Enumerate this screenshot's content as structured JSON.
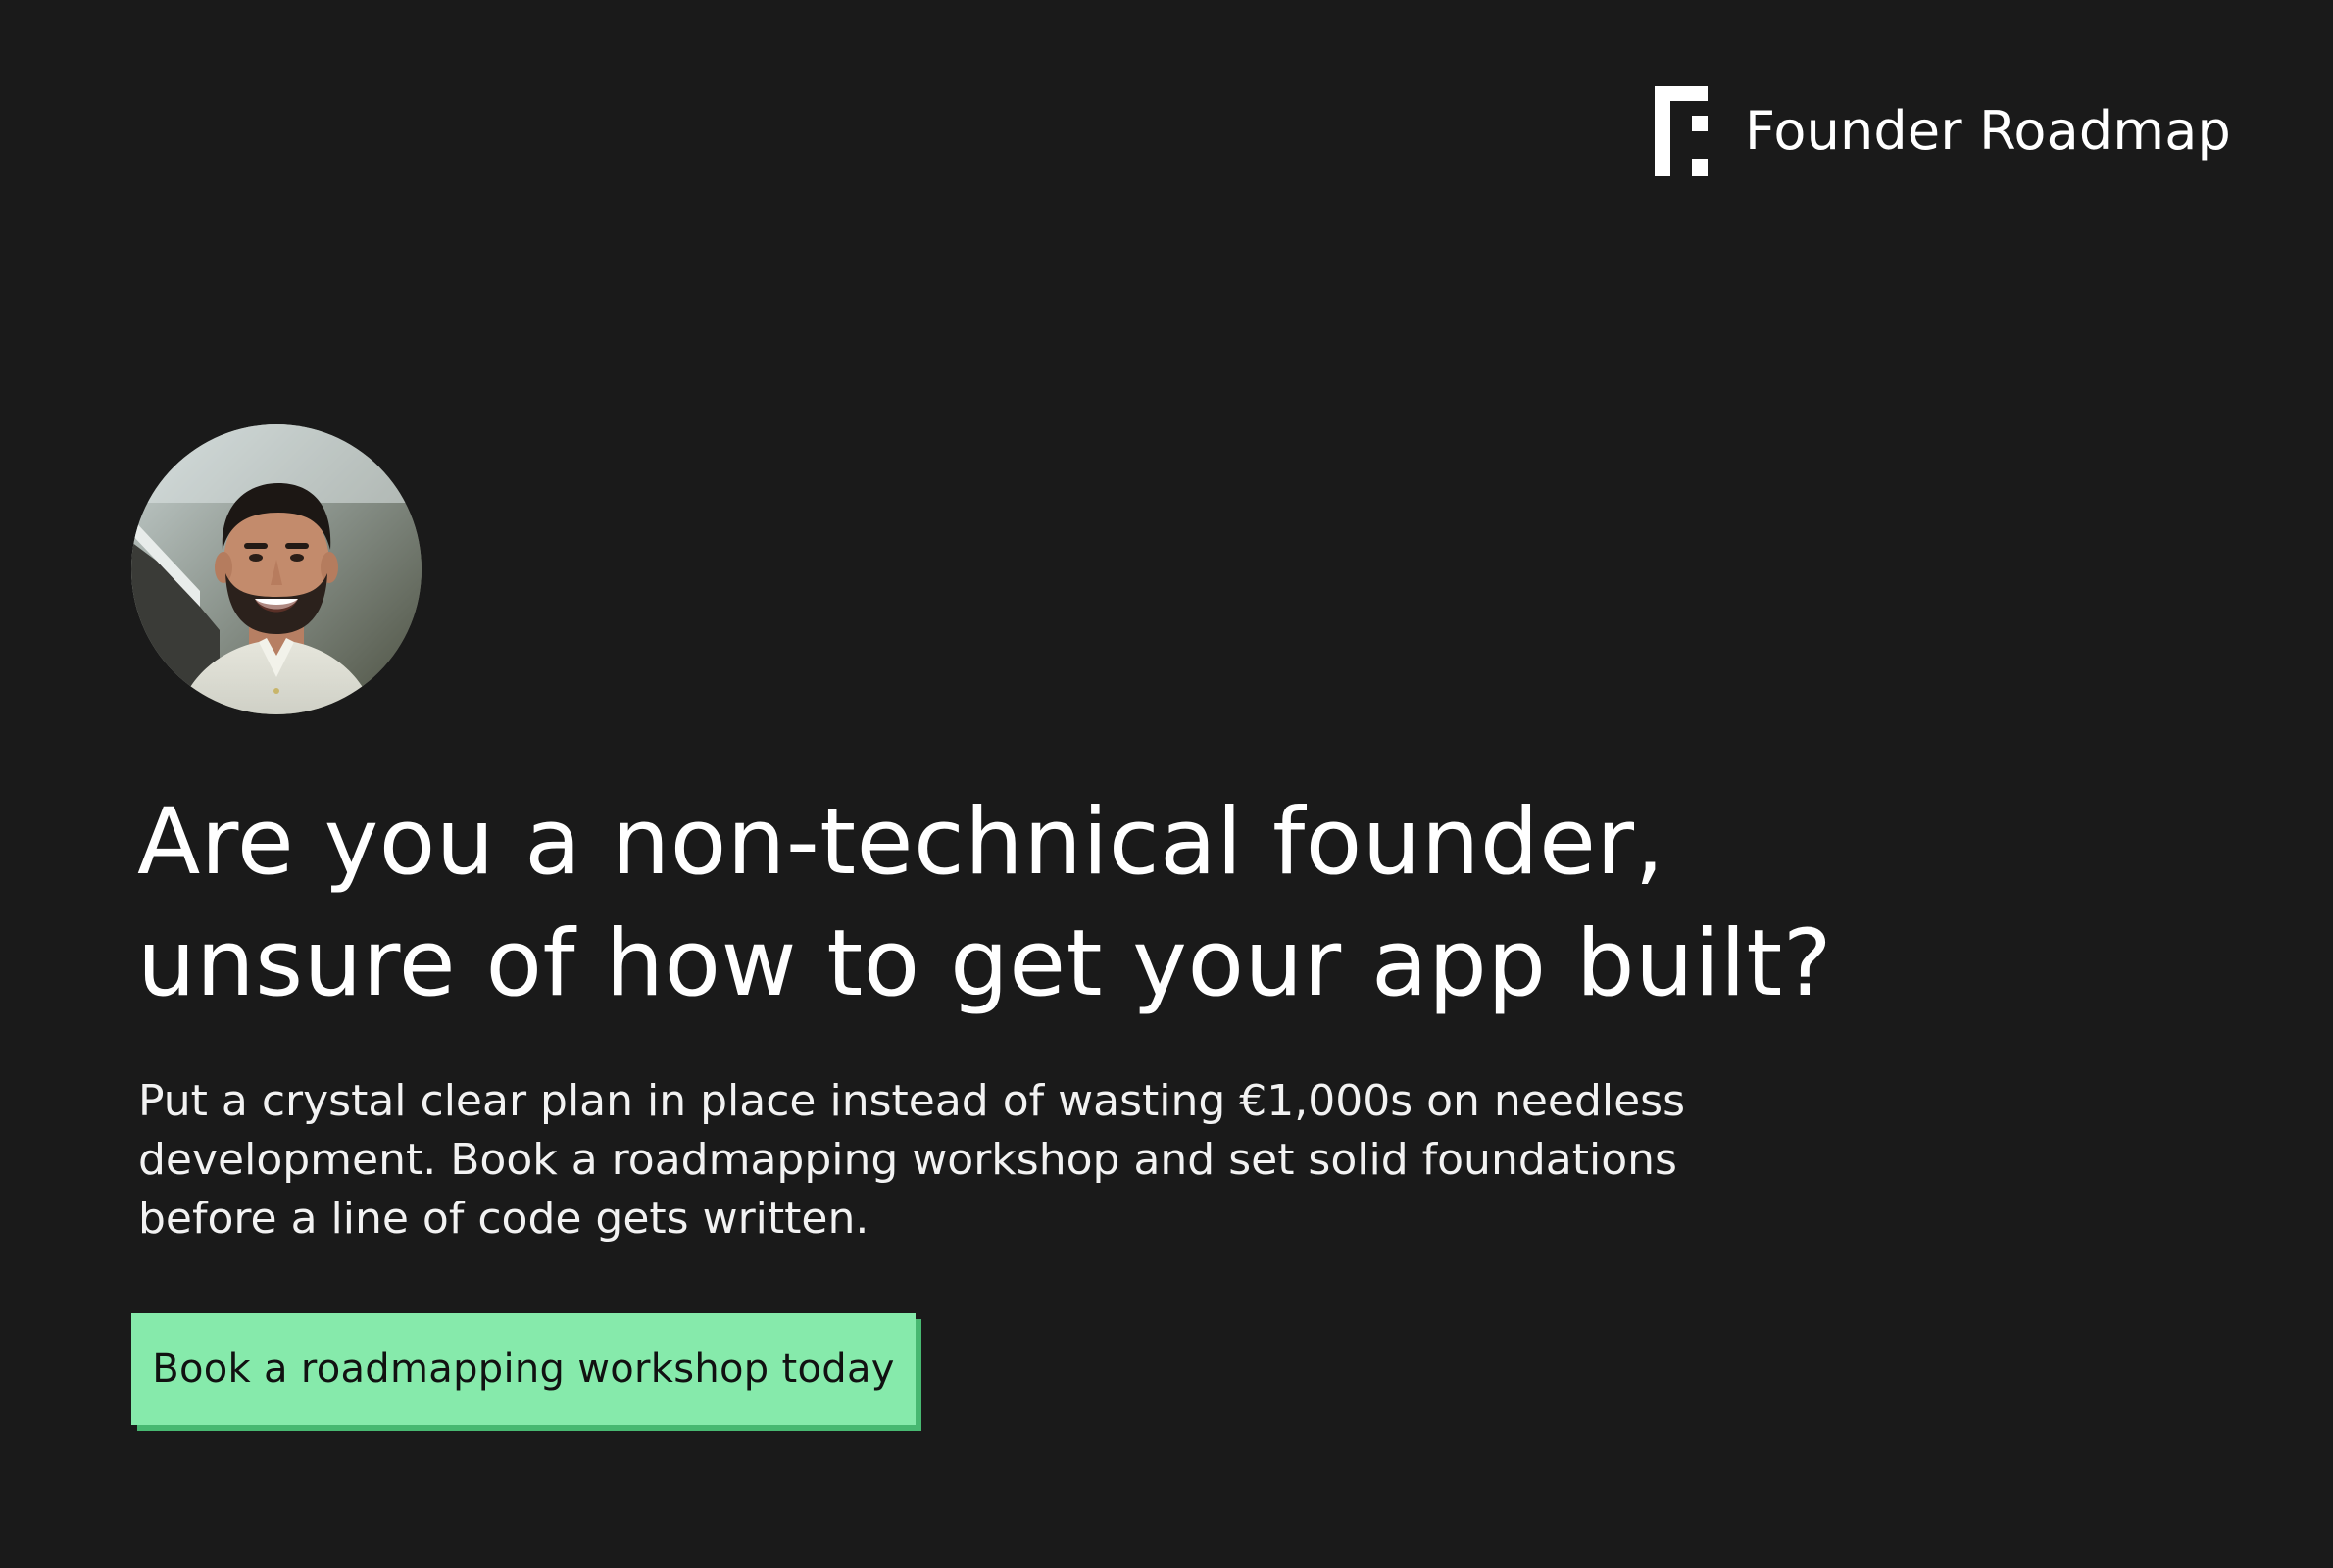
{
  "brand": {
    "logo_icon": "founder-roadmap-logo-icon",
    "name": "Founder Roadmap"
  },
  "hero": {
    "avatar_icon": "founder-portrait",
    "headline_lines": [
      "Are you a non-technical founder,",
      "unsure of how to get your app built?"
    ],
    "description_lines": [
      "Put a crystal clear plan in place instead of wasting €1,000s on needless",
      "development. Book a roadmapping workshop and set solid foundations",
      "before a line of code gets written."
    ],
    "cta_label": "Book a roadmapping workshop today"
  },
  "colors": {
    "background": "#1a1a1a",
    "text": "#ffffff",
    "cta_background": "#86eaab",
    "cta_shadow": "#47b871",
    "cta_text": "#111111"
  }
}
